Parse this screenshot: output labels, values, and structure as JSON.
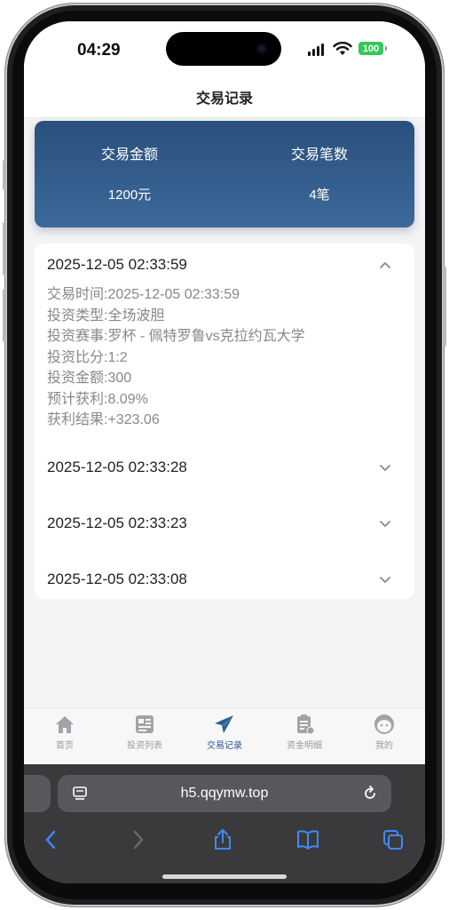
{
  "status_bar": {
    "time": "04:29",
    "battery": "100"
  },
  "page": {
    "title": "交易记录"
  },
  "summary": {
    "amount_label": "交易金额",
    "count_label": "交易笔数",
    "amount_value": "1200元",
    "count_value": "4笔"
  },
  "records": [
    {
      "datetime": "2025-12-05 02:33:59",
      "expanded": true,
      "details": [
        "交易时间:2025-12-05 02:33:59",
        "投资类型:全场波胆",
        "投资赛事:罗杯 - 佩特罗鲁vs克拉约瓦大学",
        "投资比分:1:2",
        "投资金额:300",
        "预计获利:8.09%",
        "获利结果:+323.06"
      ]
    },
    {
      "datetime": "2025-12-05 02:33:28",
      "expanded": false
    },
    {
      "datetime": "2025-12-05 02:33:23",
      "expanded": false
    },
    {
      "datetime": "2025-12-05 02:33:08",
      "expanded": false
    }
  ],
  "tabbar": {
    "items": [
      {
        "label": "首页",
        "icon": "home-icon"
      },
      {
        "label": "投资列表",
        "icon": "invest-list-icon"
      },
      {
        "label": "交易记录",
        "icon": "paper-plane-icon",
        "active": true
      },
      {
        "label": "资金明细",
        "icon": "clipboard-icon"
      },
      {
        "label": "我的",
        "icon": "face-icon"
      }
    ]
  },
  "browser": {
    "url": "h5.qqymw.top"
  },
  "colors": {
    "accent": "#2a5a8e",
    "card_gradient_top": "#2a4f7c",
    "card_gradient_bottom": "#3b6a9a",
    "battery": "#34c759"
  }
}
